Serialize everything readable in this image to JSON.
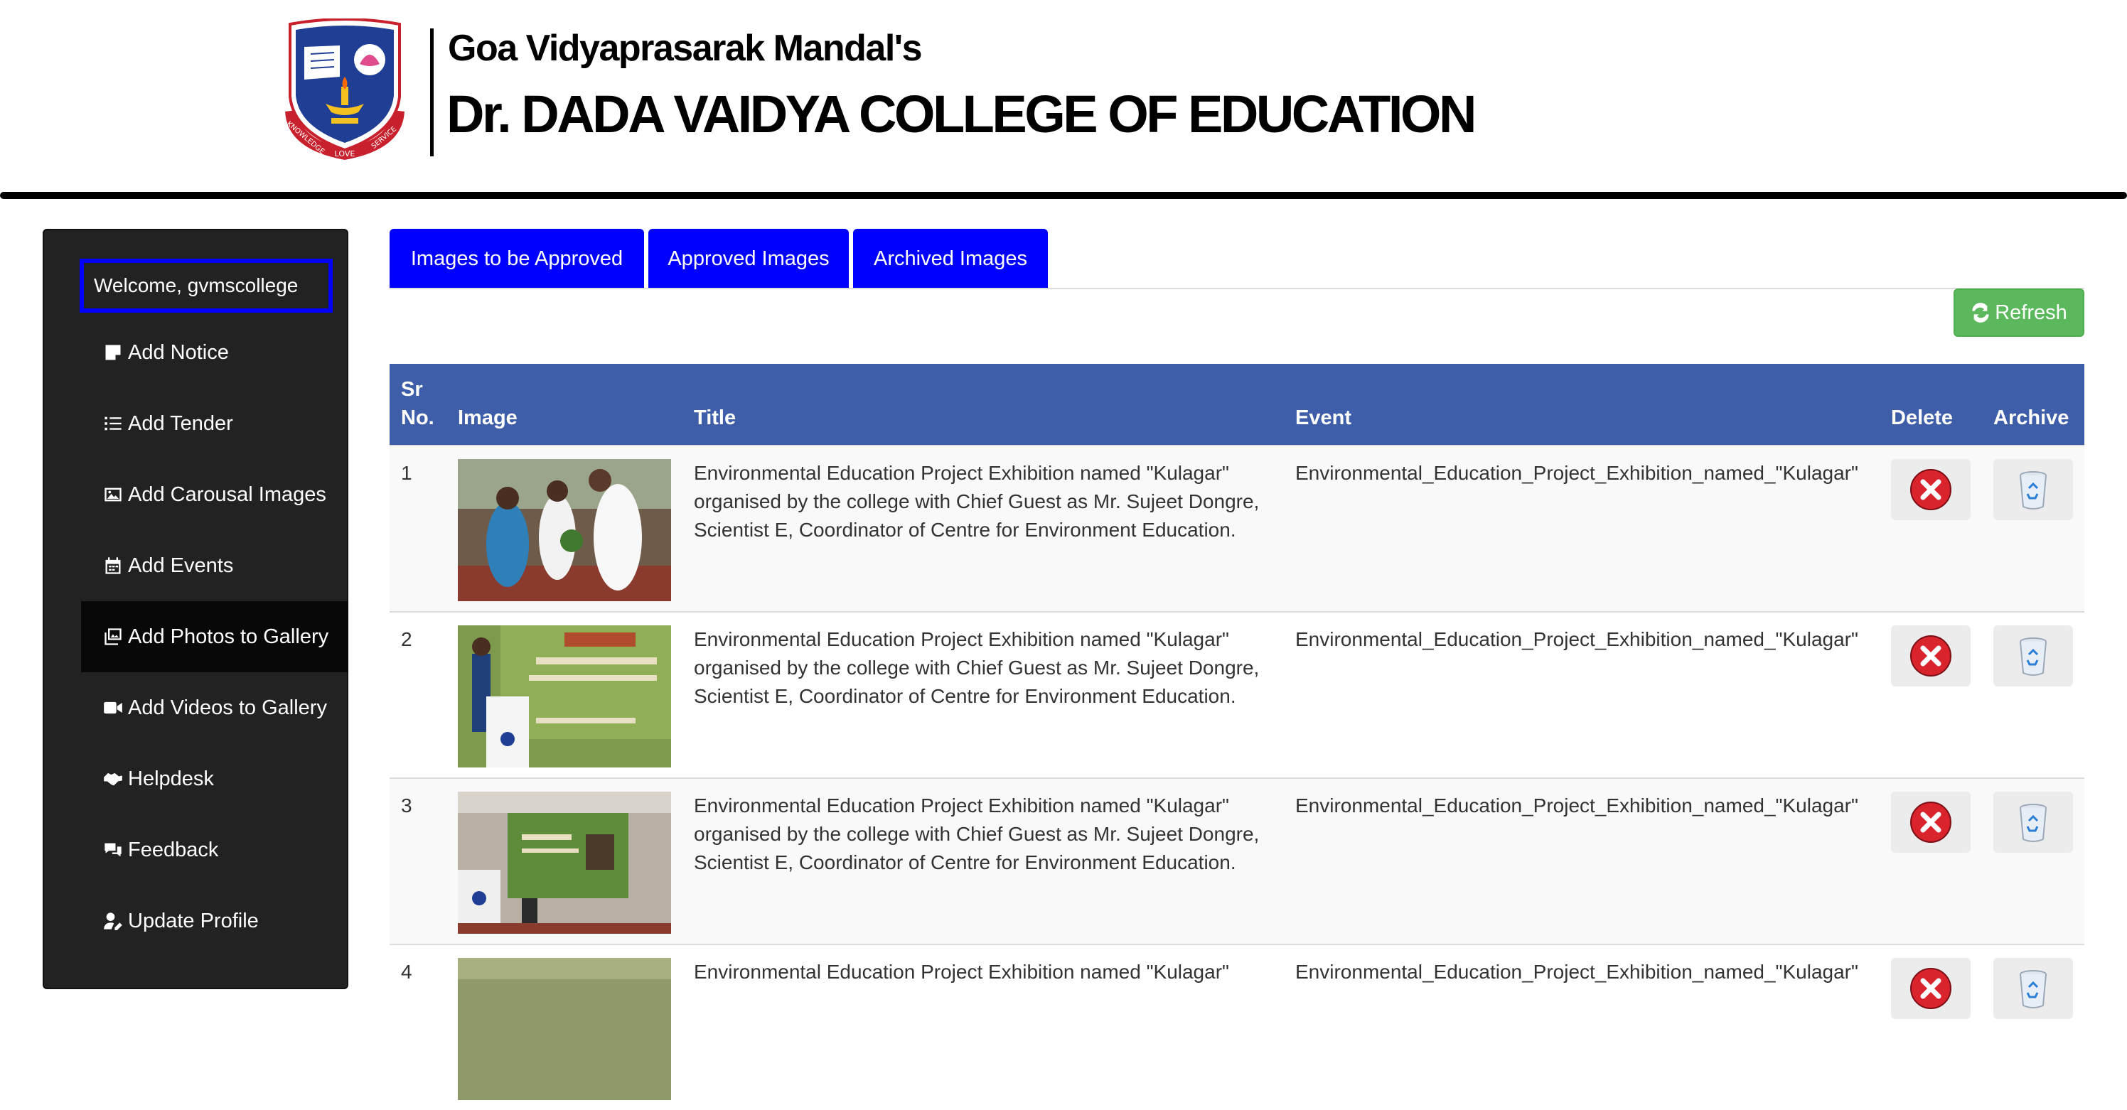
{
  "header": {
    "org_name": "Goa Vidyaprasarak Mandal's",
    "college_name": "Dr. DADA VAIDYA COLLEGE OF EDUCATION",
    "logo": {
      "icon": "college-crest-logo",
      "motto_left": "KNOWLEDGE",
      "motto_middle": "LOVE",
      "motto_right": "SERVICE"
    }
  },
  "sidebar": {
    "welcome": "Welcome, gvmscollege",
    "items": [
      {
        "label": "Add Notice",
        "icon": "sticky-note-icon"
      },
      {
        "label": "Add Tender",
        "icon": "list-icon"
      },
      {
        "label": "Add Carousal Images",
        "icon": "image-icon"
      },
      {
        "label": "Add Events",
        "icon": "calendar-icon"
      },
      {
        "label": "Add Photos to Gallery",
        "icon": "images-icon",
        "active": true
      },
      {
        "label": "Add Videos to Gallery",
        "icon": "video-icon"
      },
      {
        "label": "Helpdesk",
        "icon": "handshake-icon"
      },
      {
        "label": "Feedback",
        "icon": "comments-icon"
      },
      {
        "label": "Update Profile",
        "icon": "user-edit-icon"
      }
    ]
  },
  "tabs": [
    {
      "label": "Images to be Approved"
    },
    {
      "label": "Approved Images"
    },
    {
      "label": "Archived Images"
    }
  ],
  "refresh": {
    "label": "Refresh",
    "icon": "refresh-icon"
  },
  "table": {
    "headers": {
      "sr_line1": "Sr",
      "sr_line2": "No.",
      "image": "Image",
      "title": "Title",
      "event": "Event",
      "delete": "Delete",
      "archive": "Archive"
    },
    "rows": [
      {
        "sr": "1",
        "title": "Environmental Education Project Exhibition named \"Kulagar\" organised by the college with Chief Guest as Mr. Sujeet Dongre, Scientist E, Coordinator of Centre for Environment Education.",
        "event": "Environmental_Education_Project_Exhibition_named_\"Kulagar\""
      },
      {
        "sr": "2",
        "title": "Environmental Education Project Exhibition named \"Kulagar\" organised by the college with Chief Guest as Mr. Sujeet Dongre, Scientist E, Coordinator of Centre for Environment Education.",
        "event": "Environmental_Education_Project_Exhibition_named_\"Kulagar\""
      },
      {
        "sr": "3",
        "title": "Environmental Education Project Exhibition named \"Kulagar\" organised by the college with Chief Guest as Mr. Sujeet Dongre, Scientist E, Coordinator of Centre for Environment Education.",
        "event": "Environmental_Education_Project_Exhibition_named_\"Kulagar\""
      },
      {
        "sr": "4",
        "title": "Environmental Education Project Exhibition named \"Kulagar\"",
        "event": "Environmental_Education_Project_Exhibition_named_\"Kulagar\""
      }
    ],
    "delete_icon": "delete-x-icon",
    "archive_icon": "recycle-bin-icon"
  },
  "colors": {
    "tab_bg": "#0000ff",
    "table_header_bg": "#3f5ea9",
    "sidebar_bg": "#222222",
    "refresh_bg": "#5cb85c",
    "delete_red": "#d9232d"
  }
}
